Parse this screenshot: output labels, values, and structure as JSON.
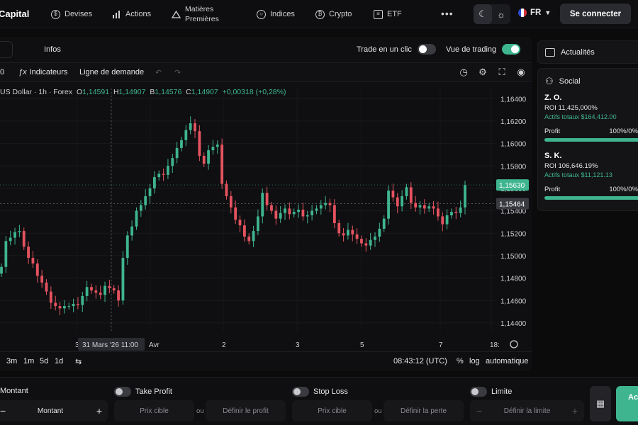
{
  "brand": "Capital",
  "nav": {
    "items": [
      {
        "label": "Devises",
        "icon": "dollar-circle-icon"
      },
      {
        "label": "Actions",
        "icon": "bar-chart-icon"
      },
      {
        "label_line1": "Matières",
        "label_line2": "Premières",
        "icon": "commodities-icon"
      },
      {
        "label": "Indices",
        "icon": "globe-icon"
      },
      {
        "label": "Crypto",
        "icon": "bitcoin-icon"
      },
      {
        "label": "ETF",
        "icon": "clipboard-icon"
      }
    ],
    "language": "FR",
    "login": "Se connecter"
  },
  "chart_panel": {
    "tab_infos": "Infos",
    "one_click_label": "Trade en un clic",
    "one_click_on": false,
    "trading_view_label": "Vue de trading",
    "trading_view_on": true,
    "toolbar": {
      "indicators": "Indicateurs",
      "demand_line": "Ligne de demande"
    },
    "legend": {
      "symbol": "US Dollar · 1h · Forex",
      "o_label": "O",
      "o": "1,14591",
      "h_label": "H",
      "h": "1,14907",
      "b_label": "B",
      "b": "1,14576",
      "c_label": "C",
      "c": "1,14907",
      "change": "+0,00318 (+0,28%)"
    },
    "bottom": {
      "ranges": [
        "3m",
        "1m",
        "5d",
        "1d"
      ],
      "time": "08:43:12 (UTC)",
      "percent": "%",
      "log": "log",
      "auto": "automatique"
    }
  },
  "chart_data": {
    "type": "candlestick",
    "xlabel": "",
    "ylabel": "",
    "y_ticks": [
      "1,16400",
      "1,16200",
      "1,16000",
      "1,15800",
      "1,15600",
      "1,15400",
      "1,15200",
      "1,15000",
      "1,14800",
      "1,14600",
      "1,14400"
    ],
    "y_tick_values": [
      1.164,
      1.162,
      1.16,
      1.158,
      1.156,
      1.154,
      1.152,
      1.15,
      1.148,
      1.146,
      1.144
    ],
    "ylim": [
      1.1433,
      1.1649
    ],
    "x_ticks": [
      "3",
      "31 Mars '26  11:00",
      "Avr",
      "2",
      "3",
      "5",
      "7",
      "18:"
    ],
    "price_labels": [
      {
        "value": 1.1563,
        "text": "1,15630",
        "color": "#3fb58f"
      },
      {
        "value": 1.15464,
        "text": "1,15464",
        "color": "#3a3b40"
      }
    ],
    "up_color": "#3fb58f",
    "down_color": "#e5535f",
    "close_series": [
      1.149,
      1.1513,
      1.1516,
      1.1521,
      1.1522,
      1.1508,
      1.1498,
      1.1493,
      1.1482,
      1.1476,
      1.1468,
      1.1458,
      1.1455,
      1.1453,
      1.1455,
      1.1455,
      1.1457,
      1.1456,
      1.1464,
      1.1472,
      1.1469,
      1.1467,
      1.1465,
      1.1473,
      1.1471,
      1.1469,
      1.146,
      1.1498,
      1.1518,
      1.1526,
      1.154,
      1.1545,
      1.1553,
      1.156,
      1.157,
      1.1573,
      1.1572,
      1.158,
      1.1587,
      1.1596,
      1.1603,
      1.1612,
      1.1618,
      1.1611,
      1.1589,
      1.1582,
      1.1594,
      1.1597,
      1.1599,
      1.1564,
      1.1553,
      1.1543,
      1.1532,
      1.1527,
      1.1517,
      1.1513,
      1.1522,
      1.1535,
      1.1556,
      1.1545,
      1.154,
      1.1533,
      1.1538,
      1.1542,
      1.1537,
      1.1539,
      1.1541,
      1.1535,
      1.1536,
      1.154,
      1.1542,
      1.1545,
      1.1547,
      1.1545,
      1.1529,
      1.152,
      1.1518,
      1.1523,
      1.1519,
      1.1515,
      1.1511,
      1.1509,
      1.1514,
      1.1517,
      1.1524,
      1.1533,
      1.1558,
      1.1552,
      1.1544,
      1.1553,
      1.1561,
      1.1547,
      1.1543,
      1.1545,
      1.1542,
      1.1544,
      1.1542,
      1.1535,
      1.1528,
      1.1536,
      1.1539,
      1.1538,
      1.1543,
      1.1563
    ]
  },
  "side": {
    "news_title": "Actualités",
    "social_title": "Social",
    "traders": [
      {
        "name": "Z. O.",
        "roi": "ROI 11,425,000%",
        "assets": "Actifs totaux $164,412.00",
        "profit_label": "Profit",
        "profit_value": "100%/0%",
        "profit_fraction": 1.0
      },
      {
        "name": "S. K.",
        "roi": "ROI 106,646.19%",
        "assets": "Actifs totaux $11,121.13",
        "profit_label": "Profit",
        "profit_value": "100%/0%",
        "profit_fraction": 1.0
      }
    ]
  },
  "order": {
    "amount_label": "Montant",
    "amount_value": "Montant",
    "take_profit_label": "Take Profit",
    "stop_loss_label": "Stop Loss",
    "limit_label": "Limite",
    "target_price": "Prix cible",
    "or": "ou",
    "define_profit": "Définir le profit",
    "define_loss": "Définir la perte",
    "define_limit": "Définir la limite",
    "action": "Ac"
  }
}
